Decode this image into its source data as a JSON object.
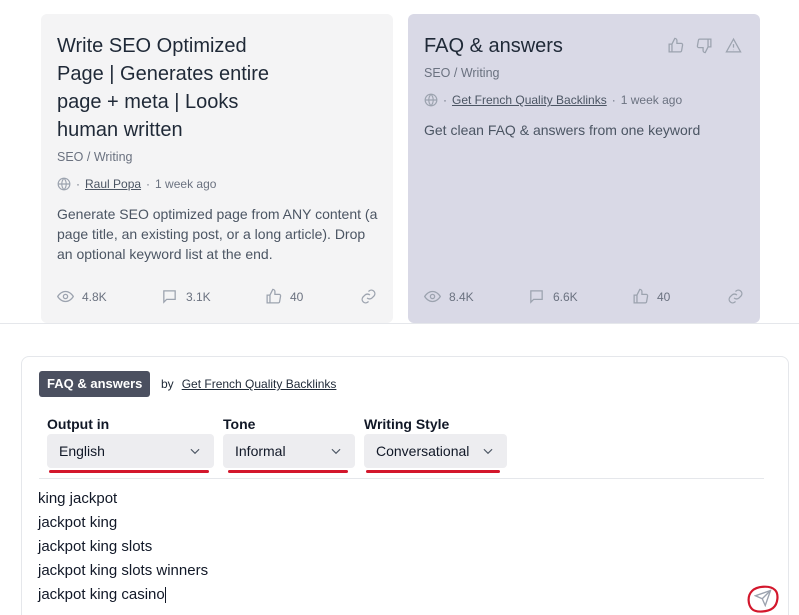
{
  "cards": [
    {
      "title": "Write SEO Optimized Page | Generates entire page + meta | Looks human written",
      "category": "SEO / Writing",
      "author": "Raul Popa",
      "time": "1 week ago",
      "description": "Generate SEO optimized page from ANY content (a page title, an existing post, or a long article). Drop an optional keyword list at the end.",
      "views": "4.8K",
      "comments": "3.1K",
      "likes": "40"
    },
    {
      "title": "FAQ & answers",
      "category": "SEO / Writing",
      "author": "Get French Quality Backlinks",
      "time": "1 week ago",
      "description": "Get clean FAQ & answers from one keyword",
      "views": "8.4K",
      "comments": "6.6K",
      "likes": "40"
    }
  ],
  "meta_separator": "·",
  "panel": {
    "badge": "FAQ & answers",
    "by_label": "by",
    "by_author": "Get French Quality Backlinks",
    "fields": [
      {
        "label": "Output in",
        "value": "English"
      },
      {
        "label": "Tone",
        "value": "Informal"
      },
      {
        "label": "Writing Style",
        "value": "Conversational"
      }
    ],
    "keywords": [
      "king jackpot",
      "jackpot king",
      "jackpot king slots",
      "jackpot king slots winners",
      "jackpot king casino"
    ]
  },
  "colors": {
    "highlight_red": "#d3172c",
    "selected_card_bg": "#d9d9e6",
    "badge_bg": "#4b5060"
  }
}
